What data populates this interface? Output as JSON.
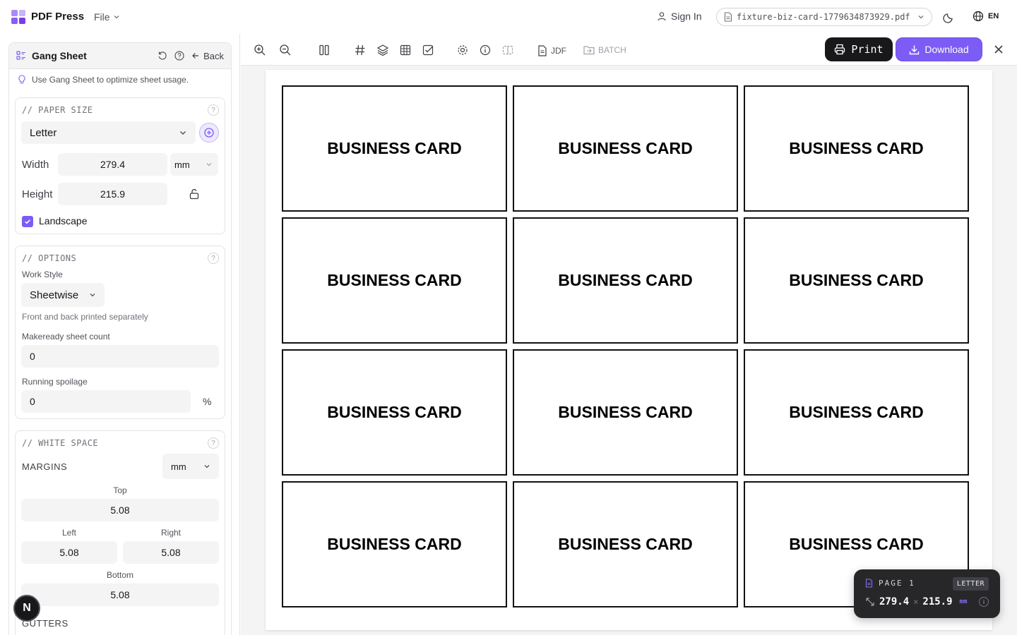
{
  "app": {
    "brand": "PDF Press",
    "file_menu": "File"
  },
  "header": {
    "sign_in": "Sign In",
    "filename": "fixture-biz-card-1779634873929.pdf",
    "language": "EN"
  },
  "sidebar": {
    "title": "Gang Sheet",
    "back": "Back",
    "hint": "Use Gang Sheet to optimize sheet usage.",
    "paper_size": {
      "label": "// PAPER SIZE",
      "preset": "Letter",
      "width_label": "Width",
      "width_value": "279.4",
      "unit": "mm",
      "height_label": "Height",
      "height_value": "215.9",
      "landscape_label": "Landscape",
      "landscape_checked": true
    },
    "options": {
      "label": "// OPTIONS",
      "work_style_label": "Work Style",
      "work_style_value": "Sheetwise",
      "work_style_desc": "Front and back printed separately",
      "makeready_label": "Makeready sheet count",
      "makeready_value": "0",
      "spoilage_label": "Running spoilage",
      "spoilage_value": "0",
      "spoilage_unit": "%"
    },
    "white_space": {
      "label": "// WHITE SPACE",
      "margins_label": "MARGINS",
      "margins_unit": "mm",
      "top_label": "Top",
      "top_value": "5.08",
      "left_label": "Left",
      "left_value": "5.08",
      "right_label": "Right",
      "right_value": "5.08",
      "bottom_label": "Bottom",
      "bottom_value": "5.08",
      "gutters_label": "GUTTERS"
    },
    "fab_label": "N"
  },
  "toolbar": {
    "jdf": "JDF",
    "batch": "BATCH",
    "print": "Print",
    "download": "Download"
  },
  "canvas": {
    "cards": [
      "BUSINESS CARD",
      "BUSINESS CARD",
      "BUSINESS CARD",
      "BUSINESS CARD",
      "BUSINESS CARD",
      "BUSINESS CARD",
      "BUSINESS CARD",
      "BUSINESS CARD",
      "BUSINESS CARD",
      "BUSINESS CARD",
      "BUSINESS CARD",
      "BUSINESS CARD"
    ]
  },
  "page_badge": {
    "page": "PAGE 1",
    "size": "LETTER",
    "width": "279.4",
    "height": "215.9",
    "unit": "mm"
  },
  "colors": {
    "accent": "#7c5cf4",
    "dark": "#18181b",
    "panel_bg": "#f4f4f5"
  }
}
